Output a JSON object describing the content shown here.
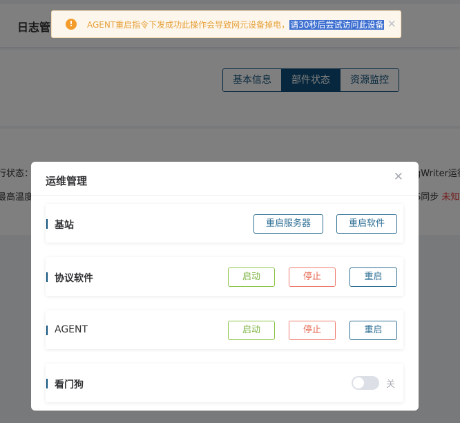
{
  "page": {
    "title": "日志管",
    "tabs": [
      {
        "label": "基本信息",
        "active": false
      },
      {
        "label": "部件状态",
        "active": true
      },
      {
        "label": "资源监控",
        "active": false
      }
    ],
    "fragments": {
      "left_row1": "行状态：",
      "left_row2": "最高温度",
      "right_row1": "gWriter运行",
      "right_row2_a": "S同步",
      "right_row2_b": "未知"
    }
  },
  "toast": {
    "icon": "warning-icon",
    "message": "AGENT重启指令下发成功此操作会导致网元设备掉电，",
    "highlight": "请30秒后尝试访问此设备",
    "color": "#e6a23c"
  },
  "dialog": {
    "title": "运维管理",
    "sections": {
      "base_station": {
        "label": "基站",
        "restart_server": "重启服务器",
        "restart_software": "重启软件"
      },
      "protocol": {
        "label": "协议软件",
        "start": "启动",
        "stop": "停止",
        "restart": "重启"
      },
      "agent": {
        "label": "AGENT",
        "start": "启动",
        "stop": "停止",
        "restart": "重启"
      },
      "watchdog": {
        "label": "看门狗",
        "toggle_state": "关"
      }
    }
  },
  "colors": {
    "primary": "#0d4f7a",
    "success": "#8bc34a",
    "danger": "#e5644f",
    "warning": "#f39c2b"
  }
}
